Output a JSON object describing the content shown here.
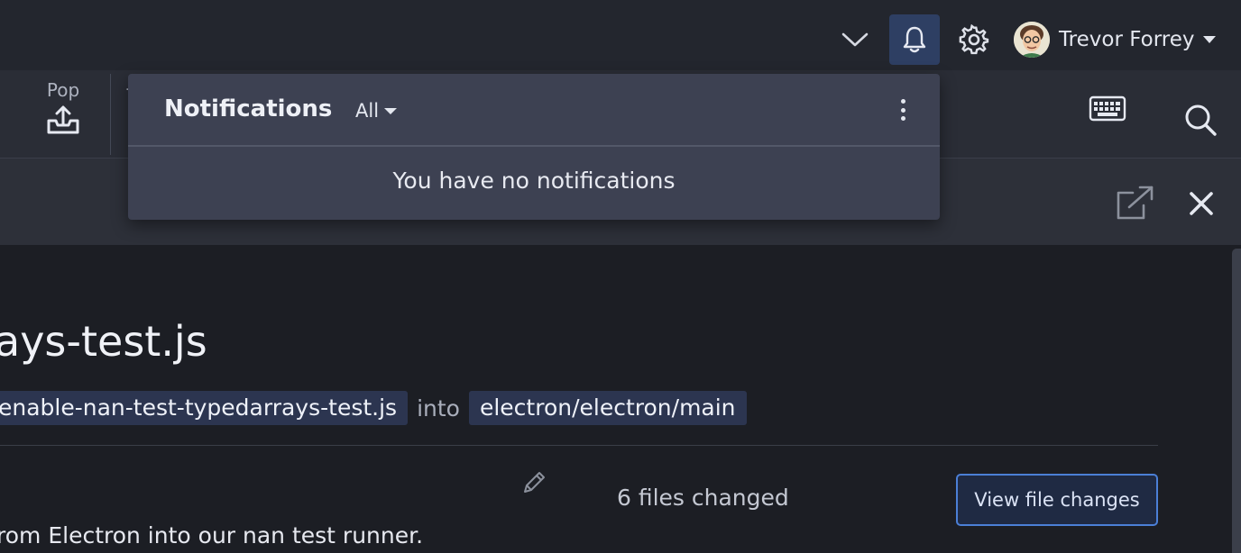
{
  "header": {
    "user_name": "Trevor Forrey",
    "icons": [
      "chevron-down-icon",
      "bell-icon",
      "gear-icon",
      "avatar",
      "caret-down-icon"
    ]
  },
  "toolbar": {
    "pop_label": "Pop",
    "icons": [
      "upload-tray-icon",
      "keyboard-icon",
      "search-icon"
    ]
  },
  "subbar": {
    "icons": [
      "open-external-icon",
      "close-icon"
    ]
  },
  "notifications": {
    "title": "Notifications",
    "filter": "All",
    "empty_message": "You have no notifications"
  },
  "pull_request": {
    "title_fragment": "ays-test.js",
    "head_branch": "enable-nan-test-typedarrays-test.js",
    "into_text": "into",
    "base_branch": "electron/electron/main",
    "files_changed": "6 files changed",
    "view_changes_label": "View file changes",
    "description_fragment": "rom Electron into our nan test runner."
  },
  "colors": {
    "accent": "#4b7fd6",
    "active_icon_bg": "#2e3f63",
    "panel_bg": "#3d4152",
    "header_bg": "#23262e"
  }
}
